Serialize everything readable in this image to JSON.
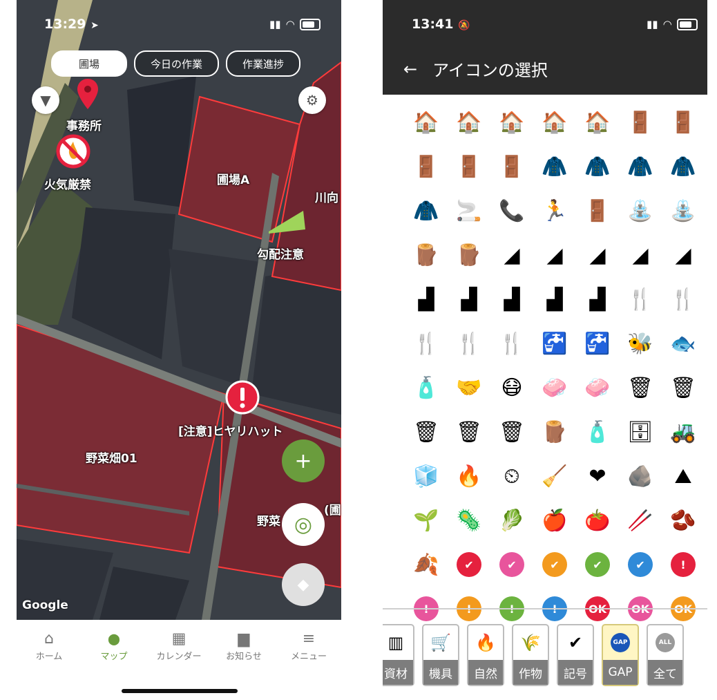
{
  "left": {
    "status": {
      "time": "13:29",
      "arrow": "➤"
    },
    "tabs": [
      {
        "label": "圃場",
        "active": true
      },
      {
        "label": "今日の作業",
        "active": false
      },
      {
        "label": "作業進捗",
        "active": false
      }
    ],
    "map_labels": {
      "office": "事務所",
      "fire": "火気厳禁",
      "field_a": "圃場A",
      "kawa": "川向",
      "slope": "勾配注意",
      "hiyari": "[注意]ヒヤリハット",
      "vegetable": "野菜畑01",
      "yasai_partial": "野菜",
      "paren_partial": "(圃",
      "google": "Google"
    },
    "fab": {
      "add": "+",
      "accent": "#6a9c3d"
    },
    "nav": [
      {
        "label": "ホーム",
        "icon": "home-icon",
        "glyph": "⌂"
      },
      {
        "label": "マップ",
        "icon": "map-pin-icon",
        "glyph": "⬤"
      },
      {
        "label": "カレンダー",
        "icon": "calendar-icon",
        "glyph": "▦"
      },
      {
        "label": "お知らせ",
        "icon": "chat-icon",
        "glyph": "▆"
      },
      {
        "label": "メニュー",
        "icon": "menu-icon",
        "glyph": "≡"
      }
    ]
  },
  "right": {
    "status": {
      "time": "13:41"
    },
    "header": {
      "back": "←",
      "title": "アイコンの選択"
    },
    "icons": [
      [
        "🏠",
        "🏠",
        "🏠",
        "🏠",
        "🏠",
        "🚪",
        "🚪"
      ],
      [
        "🚪",
        "🚪",
        "🚪",
        "🧥",
        "🧥",
        "🧥",
        "🧥"
      ],
      [
        "🧥",
        "🚬",
        "📞",
        "🏃",
        "🚪",
        "⛲",
        "⛲"
      ],
      [
        "🪵",
        "🪵",
        "◢",
        "◢",
        "◢",
        "◢",
        "◢"
      ],
      [
        "▟",
        "▟",
        "▟",
        "▟",
        "▟",
        "🍴",
        "🍴"
      ],
      [
        "🍴",
        "🍴",
        "🍴",
        "🚰",
        "🚰",
        "🐝",
        "🐟"
      ],
      [
        "🧴",
        "🤝",
        "😷",
        "🧼",
        "🧼",
        "🗑",
        "🗑"
      ],
      [
        "🗑",
        "🗑",
        "🗑",
        "🪵",
        "🧴",
        "🗄",
        "🚜"
      ],
      [
        "🧊",
        "🔥",
        "⏲",
        "🧹",
        "❤",
        "🪨",
        "⛰"
      ],
      [
        "🌱",
        "🦠",
        "🥬",
        "🍎",
        "🍅",
        "🥢",
        "🫘"
      ],
      [
        "🍂",
        "✔",
        "✔",
        "✔",
        "✔",
        "✔",
        "!"
      ],
      [
        "!",
        "!",
        "!",
        "!",
        "OK",
        "OK",
        "OK"
      ]
    ],
    "icon_circle_colors": {
      "row11": [
        "",
        "#e5213e",
        "#e8559c",
        "#f39a1e",
        "#6cb33f",
        "#2f8ad8",
        "#e5213e"
      ],
      "row12": [
        "#e8559c",
        "#f39a1e",
        "#6cb33f",
        "#2f8ad8",
        "#e5213e",
        "#e8559c",
        "#f39a1e"
      ]
    },
    "categories": [
      {
        "label": "資材",
        "glyph": "▥"
      },
      {
        "label": "機具",
        "glyph": "🛒"
      },
      {
        "label": "自然",
        "glyph": "🔥"
      },
      {
        "label": "作物",
        "glyph": "🌾"
      },
      {
        "label": "記号",
        "glyph": "✔"
      },
      {
        "label": "GAP",
        "glyph": "GAP",
        "active": true
      },
      {
        "label": "全て",
        "glyph": "ALL"
      }
    ]
  }
}
